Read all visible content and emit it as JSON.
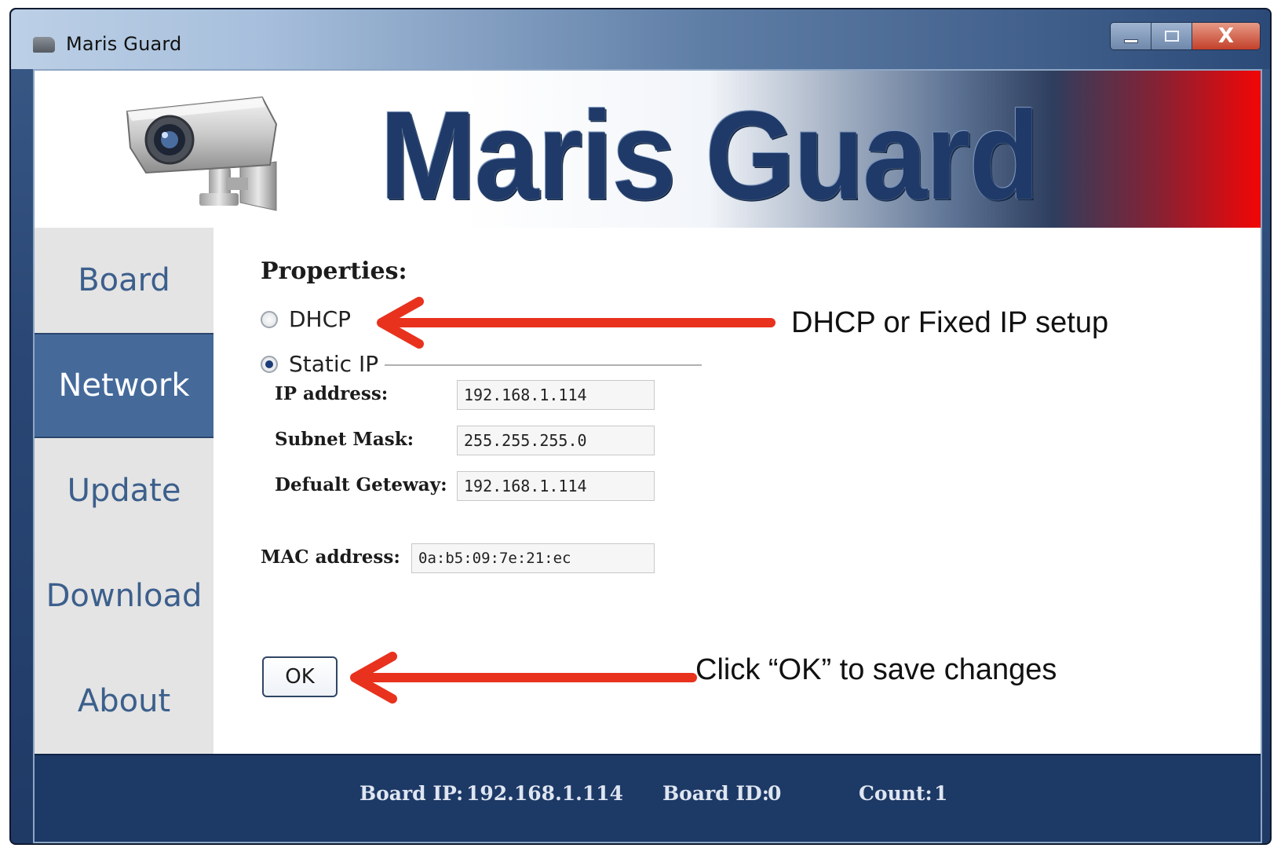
{
  "window": {
    "title": "Maris Guard",
    "close_glyph": "X"
  },
  "banner": {
    "title": "Maris Guard",
    "logo_icon": "security-camera-icon"
  },
  "sidebar": {
    "items": [
      {
        "label": "Board",
        "active": false
      },
      {
        "label": "Network",
        "active": true
      },
      {
        "label": "Update",
        "active": false
      },
      {
        "label": "Download",
        "active": false
      },
      {
        "label": "About",
        "active": false
      }
    ]
  },
  "properties": {
    "title": "Properties:",
    "dhcp_label": "DHCP",
    "static_label": "Static IP",
    "selected": "Static IP",
    "fields": {
      "ip_label": "IP address:",
      "ip_value": "192.168.1.114",
      "subnet_label": "Subnet Mask:",
      "subnet_value": "255.255.255.0",
      "gateway_label": "Defualt Geteway:",
      "gateway_value": "192.168.1.114",
      "mac_label": "MAC address:",
      "mac_value": "0a:b5:09:7e:21:ec"
    },
    "ok_label": "OK"
  },
  "annotations": {
    "dhcp_note": "DHCP or Fixed IP setup",
    "ok_note": "Click “OK” to save changes",
    "arrow_color": "#e8321e"
  },
  "status": {
    "board_ip_label": "Board IP:",
    "board_ip_value": "192.168.1.114",
    "board_id_label": "Board ID:",
    "board_id_value": "0",
    "count_label": "Count:",
    "count_value": "1"
  },
  "colors": {
    "accent": "#456a9a",
    "statusbar": "#1d3966",
    "sidebar_bg": "#e4e4e4",
    "nav_text": "#3c5f8c",
    "close_button": "#c3402a"
  }
}
